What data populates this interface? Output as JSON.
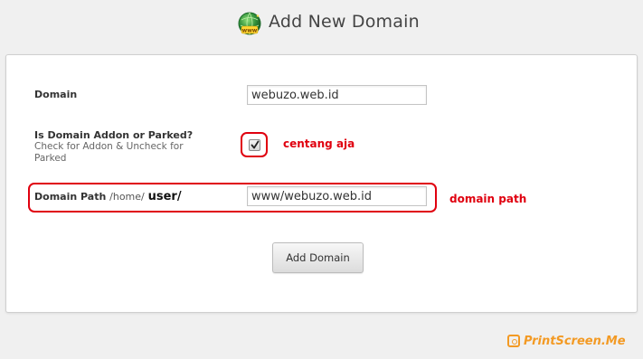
{
  "header": {
    "title": "Add New Domain",
    "icon": "globe-www-icon"
  },
  "form": {
    "domain": {
      "label": "Domain",
      "value": "webuzo.web.id"
    },
    "addon": {
      "label": "Is Domain Addon or Parked?",
      "help": "Check for Addon & Uncheck for Parked",
      "checked": true
    },
    "path": {
      "label": "Domain Path",
      "prefix": "/home/",
      "user": "user/",
      "value": "www/webuzo.web.id"
    },
    "submit_label": "Add Domain"
  },
  "annotations": {
    "checkbox_note": "centang aja",
    "path_note": "domain path",
    "color": "#e0000f"
  },
  "watermark": {
    "text": "PrintScreen.Me",
    "color": "#f39a24"
  }
}
